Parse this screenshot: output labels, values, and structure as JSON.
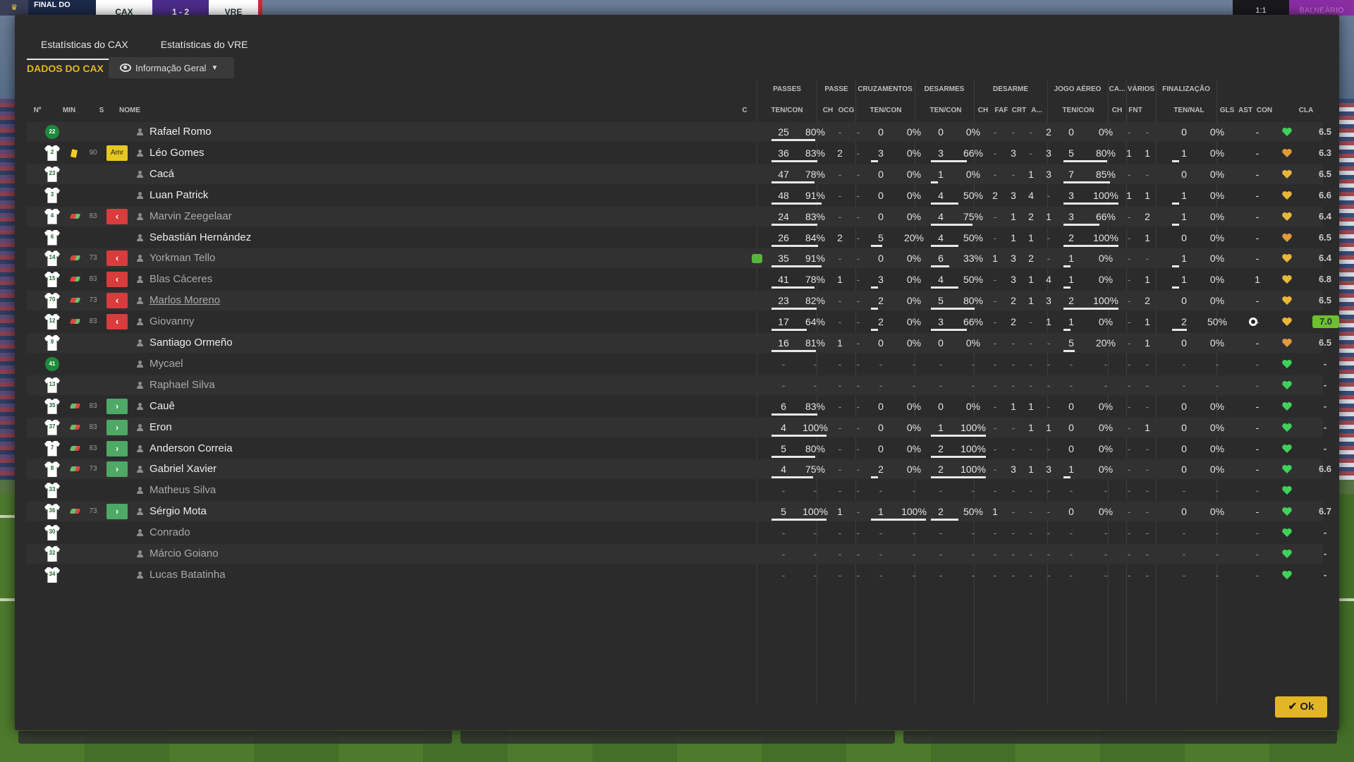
{
  "scoreboard": {
    "status": "FINAL DO",
    "home": "CAX",
    "score": "1 - 2",
    "away": "VRE",
    "clock": "1:1",
    "pause": "BALNEÁRIO"
  },
  "tabs": [
    "Estatísticas do CAX",
    "Estatísticas do VRE"
  ],
  "section_label": "DADOS DO CAX",
  "view_dropdown": "Informação Geral",
  "group_headers": {
    "passes": "PASSES",
    "passe": "PASSE",
    "cruzamentos": "CRUZAMENTOS",
    "desarmes": "DESARMES",
    "desarme": "DESARME",
    "jogo_aereo": "JOGO AÉREO",
    "ca": "CA...",
    "varios": "VÁRIOS",
    "finalizacao": "FINALIZAÇÃO"
  },
  "column_headers": {
    "num": "Nº",
    "min": "MIN",
    "s": "S",
    "nome": "NOME",
    "c": "C",
    "passes": "TEN/CON",
    "passe_ch": "CH",
    "passe_ocg": "OCG",
    "cruz": "TEN/CON",
    "desarmes": "TEN/CON",
    "des_ch": "CH",
    "des_faf": "FAF",
    "des_crt": "CRT",
    "des_a": "A...",
    "aereo": "TEN/CON",
    "ca_ch": "CH",
    "fnt": "FNT",
    "final": "TEN/NAL",
    "gls": "GLS",
    "ast": "AST",
    "con": "CON",
    "cla": "CLA"
  },
  "colors": {
    "accent": "#e3b626",
    "sub_out": "#d83c3c",
    "sub_in": "#4ea866",
    "best_rating": "#6dbf2e"
  },
  "rows": [
    {
      "num": "22",
      "kit": "gk",
      "min": "",
      "s": "",
      "name": "Rafael Romo",
      "p": [
        "25",
        "80%"
      ],
      "pch": "-",
      "pocg": "-",
      "cr": [
        "0",
        "0%"
      ],
      "de": [
        "0",
        "0%"
      ],
      "dch": "-",
      "faf": "-",
      "crt": "-",
      "a": "2",
      "ae": [
        "0",
        "0%"
      ],
      "cach": "-",
      "fnt": "-",
      "fi": [
        "0",
        "0%"
      ],
      "gls": "",
      "ast": "-",
      "con": "green",
      "cla": "6.5"
    },
    {
      "num": "2",
      "kit": "white",
      "min": "90",
      "s": "Amr",
      "name": "Léo Gomes",
      "p": [
        "36",
        "83%"
      ],
      "pch": "2",
      "pocg": "-",
      "cr": [
        "3",
        "0%"
      ],
      "de": [
        "3",
        "66%"
      ],
      "dch": "-",
      "faf": "3",
      "crt": "-",
      "a": "3",
      "ae": [
        "5",
        "80%"
      ],
      "cach": "1",
      "fnt": "1",
      "fi": [
        "1",
        "0%"
      ],
      "gls": "",
      "ast": "-",
      "con": "orange",
      "cla": "6.3"
    },
    {
      "num": "23",
      "kit": "white",
      "min": "",
      "s": "",
      "name": "Cacá",
      "p": [
        "47",
        "78%"
      ],
      "pch": "-",
      "pocg": "-",
      "cr": [
        "0",
        "0%"
      ],
      "de": [
        "1",
        "0%"
      ],
      "dch": "-",
      "faf": "-",
      "crt": "1",
      "a": "3",
      "ae": [
        "7",
        "85%"
      ],
      "cach": "-",
      "fnt": "-",
      "fi": [
        "0",
        "0%"
      ],
      "gls": "",
      "ast": "-",
      "con": "gold",
      "cla": "6.5"
    },
    {
      "num": "3",
      "kit": "white",
      "min": "",
      "s": "",
      "name": "Luan Patrick",
      "p": [
        "48",
        "91%"
      ],
      "pch": "-",
      "pocg": "-",
      "cr": [
        "0",
        "0%"
      ],
      "de": [
        "4",
        "50%"
      ],
      "dch": "2",
      "faf": "3",
      "crt": "4",
      "a": "-",
      "ae": [
        "3",
        "100%"
      ],
      "cach": "1",
      "fnt": "1",
      "fi": [
        "1",
        "0%"
      ],
      "gls": "",
      "ast": "-",
      "con": "gold",
      "cla": "6.6"
    },
    {
      "num": "4",
      "kit": "white",
      "min": "83",
      "s": "out",
      "name": "Marvin Zeegelaar",
      "p": [
        "24",
        "83%"
      ],
      "pch": "-",
      "pocg": "-",
      "cr": [
        "0",
        "0%"
      ],
      "de": [
        "4",
        "75%"
      ],
      "dch": "-",
      "faf": "1",
      "crt": "2",
      "a": "1",
      "ae": [
        "3",
        "66%"
      ],
      "cach": "-",
      "fnt": "2",
      "fi": [
        "1",
        "0%"
      ],
      "gls": "",
      "ast": "-",
      "con": "gold",
      "cla": "6.4"
    },
    {
      "num": "6",
      "kit": "white",
      "min": "",
      "s": "",
      "name": "Sebastián Hernández",
      "p": [
        "26",
        "84%"
      ],
      "pch": "2",
      "pocg": "-",
      "cr": [
        "5",
        "20%"
      ],
      "de": [
        "4",
        "50%"
      ],
      "dch": "-",
      "faf": "1",
      "crt": "1",
      "a": "-",
      "ae": [
        "2",
        "100%"
      ],
      "cach": "-",
      "fnt": "1",
      "fi": [
        "0",
        "0%"
      ],
      "gls": "",
      "ast": "-",
      "con": "orange",
      "cla": "6.5"
    },
    {
      "num": "14",
      "kit": "white",
      "min": "73",
      "s": "out",
      "name": "Yorkman Tello",
      "c": true,
      "p": [
        "35",
        "91%"
      ],
      "pch": "-",
      "pocg": "-",
      "cr": [
        "0",
        "0%"
      ],
      "de": [
        "6",
        "33%"
      ],
      "dch": "1",
      "faf": "3",
      "crt": "2",
      "a": "-",
      "ae": [
        "1",
        "0%"
      ],
      "cach": "-",
      "fnt": "-",
      "fi": [
        "1",
        "0%"
      ],
      "gls": "",
      "ast": "-",
      "con": "gold",
      "cla": "6.4"
    },
    {
      "num": "15",
      "kit": "white",
      "min": "83",
      "s": "out",
      "name": "Blas Cáceres",
      "p": [
        "41",
        "78%"
      ],
      "pch": "1",
      "pocg": "-",
      "cr": [
        "3",
        "0%"
      ],
      "de": [
        "4",
        "50%"
      ],
      "dch": "-",
      "faf": "3",
      "crt": "1",
      "a": "4",
      "ae": [
        "1",
        "0%"
      ],
      "cach": "-",
      "fnt": "1",
      "fi": [
        "1",
        "0%"
      ],
      "gls": "",
      "ast": "1",
      "con": "gold",
      "cla": "6.8"
    },
    {
      "num": "70",
      "kit": "white",
      "min": "73",
      "s": "out",
      "name": "Marlos Moreno",
      "p": [
        "23",
        "82%"
      ],
      "pch": "-",
      "pocg": "-",
      "cr": [
        "2",
        "0%"
      ],
      "de": [
        "5",
        "80%"
      ],
      "dch": "-",
      "faf": "2",
      "crt": "1",
      "a": "3",
      "ae": [
        "2",
        "100%"
      ],
      "cach": "-",
      "fnt": "2",
      "fi": [
        "0",
        "0%"
      ],
      "gls": "",
      "ast": "-",
      "con": "gold",
      "cla": "6.5"
    },
    {
      "num": "12",
      "kit": "white",
      "min": "83",
      "s": "out",
      "name": "Giovanny",
      "p": [
        "17",
        "64%"
      ],
      "pch": "-",
      "pocg": "-",
      "cr": [
        "2",
        "0%"
      ],
      "de": [
        "3",
        "66%"
      ],
      "dch": "-",
      "faf": "2",
      "crt": "-",
      "a": "1",
      "ae": [
        "1",
        "0%"
      ],
      "cach": "-",
      "fnt": "1",
      "fi": [
        "2",
        "50%"
      ],
      "gls": "ball",
      "ast": "-",
      "con": "gold",
      "cla": "7.0",
      "best": true
    },
    {
      "num": "9",
      "kit": "white",
      "min": "",
      "s": "",
      "name": "Santiago Ormeño",
      "p": [
        "16",
        "81%"
      ],
      "pch": "1",
      "pocg": "-",
      "cr": [
        "0",
        "0%"
      ],
      "de": [
        "0",
        "0%"
      ],
      "dch": "-",
      "faf": "-",
      "crt": "-",
      "a": "-",
      "ae": [
        "5",
        "20%"
      ],
      "cach": "-",
      "fnt": "1",
      "fi": [
        "0",
        "0%"
      ],
      "gls": "",
      "ast": "-",
      "con": "orange",
      "cla": "6.5"
    },
    {
      "num": "41",
      "kit": "gk",
      "min": "",
      "s": "",
      "name": "Mycael",
      "empty": true,
      "con": "green",
      "cla": "-"
    },
    {
      "num": "13",
      "kit": "white",
      "min": "",
      "s": "",
      "name": "Raphael Silva",
      "empty": true,
      "con": "green",
      "cla": "-"
    },
    {
      "num": "35",
      "kit": "white",
      "min": "83",
      "s": "in",
      "name": "Cauê",
      "p": [
        "6",
        "83%"
      ],
      "pch": "-",
      "pocg": "-",
      "cr": [
        "0",
        "0%"
      ],
      "de": [
        "0",
        "0%"
      ],
      "dch": "-",
      "faf": "1",
      "crt": "1",
      "a": "-",
      "ae": [
        "0",
        "0%"
      ],
      "cach": "-",
      "fnt": "-",
      "fi": [
        "0",
        "0%"
      ],
      "gls": "",
      "ast": "-",
      "con": "green",
      "cla": "-"
    },
    {
      "num": "37",
      "kit": "white",
      "min": "83",
      "s": "in",
      "name": "Eron",
      "p": [
        "4",
        "100%"
      ],
      "pch": "-",
      "pocg": "-",
      "cr": [
        "0",
        "0%"
      ],
      "de": [
        "1",
        "100%"
      ],
      "dch": "-",
      "faf": "-",
      "crt": "1",
      "a": "1",
      "ae": [
        "0",
        "0%"
      ],
      "cach": "-",
      "fnt": "1",
      "fi": [
        "0",
        "0%"
      ],
      "gls": "",
      "ast": "-",
      "con": "green",
      "cla": "-"
    },
    {
      "num": "7",
      "kit": "white",
      "min": "83",
      "s": "in",
      "name": "Anderson Correia",
      "p": [
        "5",
        "80%"
      ],
      "pch": "-",
      "pocg": "-",
      "cr": [
        "0",
        "0%"
      ],
      "de": [
        "2",
        "100%"
      ],
      "dch": "-",
      "faf": "-",
      "crt": "-",
      "a": "-",
      "ae": [
        "0",
        "0%"
      ],
      "cach": "-",
      "fnt": "-",
      "fi": [
        "0",
        "0%"
      ],
      "gls": "",
      "ast": "-",
      "con": "green",
      "cla": "-"
    },
    {
      "num": "8",
      "kit": "white",
      "min": "73",
      "s": "in",
      "name": "Gabriel Xavier",
      "p": [
        "4",
        "75%"
      ],
      "pch": "-",
      "pocg": "-",
      "cr": [
        "2",
        "0%"
      ],
      "de": [
        "2",
        "100%"
      ],
      "dch": "-",
      "faf": "3",
      "crt": "1",
      "a": "3",
      "ae": [
        "1",
        "0%"
      ],
      "cach": "-",
      "fnt": "-",
      "fi": [
        "0",
        "0%"
      ],
      "gls": "",
      "ast": "-",
      "con": "green",
      "cla": "6.6"
    },
    {
      "num": "33",
      "kit": "white",
      "min": "",
      "s": "",
      "name": "Matheus Silva",
      "empty": true,
      "con": "green",
      "cla": ""
    },
    {
      "num": "36",
      "kit": "white",
      "min": "73",
      "s": "in",
      "name": "Sérgio Mota",
      "p": [
        "5",
        "100%"
      ],
      "pch": "1",
      "pocg": "-",
      "cr": [
        "1",
        "100%"
      ],
      "de": [
        "2",
        "50%"
      ],
      "dch": "1",
      "faf": "-",
      "crt": "-",
      "a": "-",
      "ae": [
        "0",
        "0%"
      ],
      "cach": "-",
      "fnt": "-",
      "fi": [
        "0",
        "0%"
      ],
      "gls": "",
      "ast": "-",
      "con": "green",
      "cla": "6.7"
    },
    {
      "num": "30",
      "kit": "white",
      "min": "",
      "s": "",
      "name": "Conrado",
      "empty": true,
      "con": "green",
      "cla": "-"
    },
    {
      "num": "32",
      "kit": "white",
      "min": "",
      "s": "",
      "name": "Márcio Goiano",
      "empty": true,
      "con": "green",
      "cla": "-"
    },
    {
      "num": "34",
      "kit": "white",
      "min": "",
      "s": "",
      "name": "Lucas Batatinha",
      "empty": true,
      "con": "green",
      "cla": "-"
    }
  ],
  "ok_button": "Ok"
}
